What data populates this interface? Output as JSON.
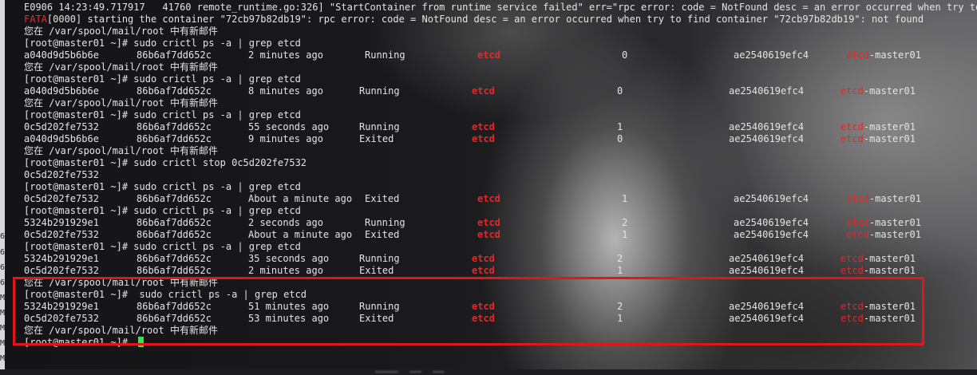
{
  "header_lines": [
    {
      "text": "E0906 14:23:49.717917   41760 remote_runtime.go:326] \"StartContainer from runtime service failed\" err=\"rpc error: code = NotFound desc = an error occurred when try to find"
    },
    {
      "prefix": "FATA",
      "text": "[0000] starting the container \"72cb97b82db19\": rpc error: code = NotFound desc = an error occurred when try to find container \"72cb97b82db19\": not found"
    }
  ],
  "mail_msg": "您在 /var/spool/mail/root 中有新邮件",
  "prompt": "[root@master01 ~]# ",
  "commands": {
    "ps": "sudo crictl ps -a | grep etcd",
    "ps_spaced": " sudo crictl ps -a | grep etcd",
    "stop": "sudo crictl stop 0c5d202fe7532",
    "stop_output": "0c5d202fe7532"
  },
  "rows": [
    {
      "id": "a040d9d5b6b6e",
      "image": "86b6af7dd652c",
      "created": "2 minutes ago",
      "state": "Running",
      "name": "etcd",
      "attempt": "0",
      "pod": "ae2540619efc4",
      "podname_red": "etcd",
      "podname_rest": "-master01"
    },
    {
      "id": "a040d9d5b6b6e",
      "image": "86b6af7dd652c",
      "created": "8 minutes ago",
      "state": "Running",
      "name": "etcd",
      "attempt": "0",
      "pod": "ae2540619efc4",
      "podname_red": "etcd",
      "podname_rest": "-master01"
    },
    {
      "id": "0c5d202fe7532",
      "image": "86b6af7dd652c",
      "created": "55 seconds ago",
      "state": "Running",
      "name": "etcd",
      "attempt": "1",
      "pod": "ae2540619efc4",
      "podname_red": "etcd",
      "podname_rest": "-master01"
    },
    {
      "id": "a040d9d5b6b6e",
      "image": "86b6af7dd652c",
      "created": "9 minutes ago",
      "state": "Exited",
      "name": "etcd",
      "attempt": "0",
      "pod": "ae2540619efc4",
      "podname_red": "etcd",
      "podname_rest": "-master01"
    },
    {
      "id": "0c5d202fe7532",
      "image": "86b6af7dd652c",
      "created": "About a minute ago",
      "state": "Exited",
      "name": "etcd",
      "attempt": "1",
      "pod": "ae2540619efc4",
      "podname_red": "etcd",
      "podname_rest": "-master01"
    },
    {
      "id": "5324b291929e1",
      "image": "86b6af7dd652c",
      "created": "2 seconds ago",
      "state": "Running",
      "name": "etcd",
      "attempt": "2",
      "pod": "ae2540619efc4",
      "podname_red": "etcd",
      "podname_rest": "-master01"
    },
    {
      "id": "0c5d202fe7532",
      "image": "86b6af7dd652c",
      "created": "About a minute ago",
      "state": "Exited",
      "name": "etcd",
      "attempt": "1",
      "pod": "ae2540619efc4",
      "podname_red": "etcd",
      "podname_rest": "-master01"
    },
    {
      "id": "5324b291929e1",
      "image": "86b6af7dd652c",
      "created": "35 seconds ago",
      "state": "Running",
      "name": "etcd",
      "attempt": "2",
      "pod": "ae2540619efc4",
      "podname_red": "etcd",
      "podname_rest": "-master01"
    },
    {
      "id": "0c5d202fe7532",
      "image": "86b6af7dd652c",
      "created": "2 minutes ago",
      "state": "Exited",
      "name": "etcd",
      "attempt": "1",
      "pod": "ae2540619efc4",
      "podname_red": "etcd",
      "podname_rest": "-master01"
    },
    {
      "id": "5324b291929e1",
      "image": "86b6af7dd652c",
      "created": "51 minutes ago",
      "state": "Running",
      "name": "etcd",
      "attempt": "2",
      "pod": "ae2540619efc4",
      "podname_red": "etcd",
      "podname_rest": "-master01"
    },
    {
      "id": "0c5d202fe7532",
      "image": "86b6af7dd652c",
      "created": "53 minutes ago",
      "state": "Exited",
      "name": "etcd",
      "attempt": "1",
      "pod": "ae2540619efc4",
      "podname_red": "etcd",
      "podname_rest": "-master01"
    }
  ],
  "left_strip_chars": [
    "6",
    "6",
    "6",
    "6",
    "M",
    "M",
    "M",
    "M",
    "M"
  ],
  "bottom_blur_text": "…………  ……  ……",
  "colors": {
    "red": "#e42828",
    "cursor": "#2ee84a",
    "highlight": "#e0161b",
    "text": "#e4e4e4"
  }
}
